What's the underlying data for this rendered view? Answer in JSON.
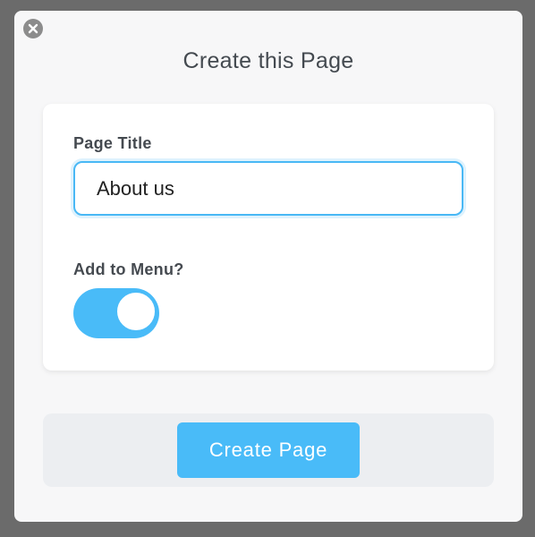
{
  "dialog": {
    "title": "Create this Page",
    "close_icon": "close-icon"
  },
  "form": {
    "page_title_label": "Page Title",
    "page_title_value": "About us",
    "add_to_menu_label": "Add to Menu?",
    "add_to_menu_enabled": true
  },
  "footer": {
    "create_button_label": "Create Page"
  },
  "colors": {
    "accent": "#49bbf8",
    "text": "#454a50",
    "dialog_bg": "#f7f7f8",
    "backdrop": "#6b6b6b"
  }
}
